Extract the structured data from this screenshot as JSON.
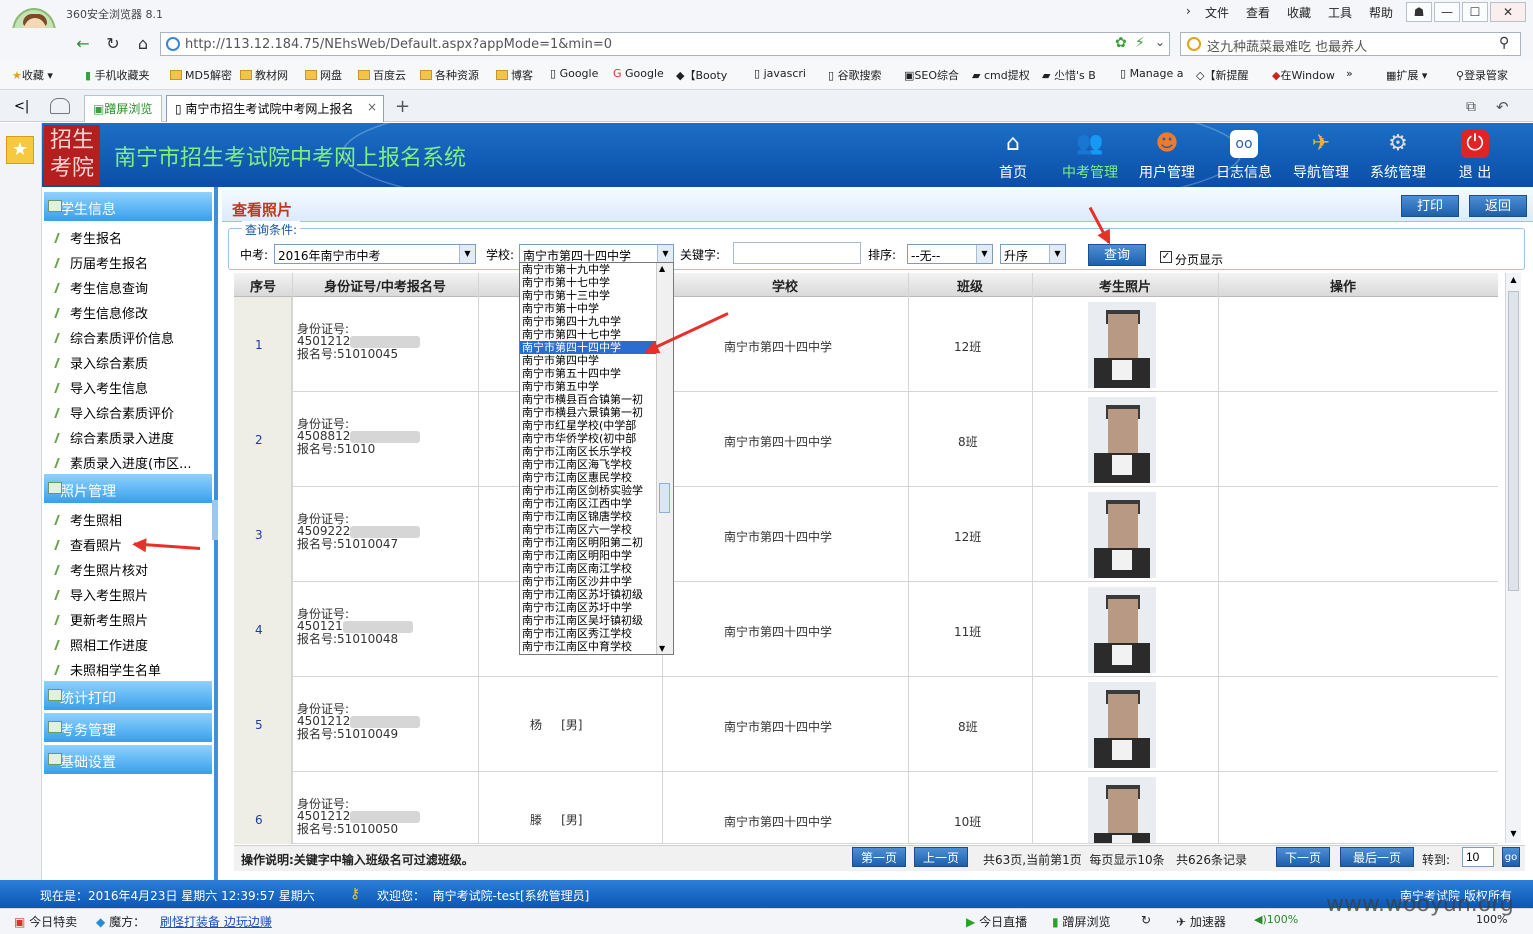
{
  "browser": {
    "app_name": "360安全浏览器 8.1",
    "menu": [
      "文件",
      "查看",
      "收藏",
      "工具",
      "帮助"
    ],
    "url": "http://113.12.184.75/NEhsWeb/Default.aspx?appMode=1&min=0",
    "search_text": "这九种蔬菜最难吃 也最养人",
    "bookmarks": [
      "收藏",
      "手机收藏夹",
      "MD5解密",
      "教材网",
      "网盘",
      "百度云",
      "各种资源",
      "博客",
      "Google",
      "Google",
      "【Booty",
      "javascri",
      "谷歌搜索",
      "SEO综合",
      "cmd提权",
      "尐惜's B",
      "Manage a",
      "【新提醒",
      "在Window"
    ],
    "bookmark_right": [
      "扩展",
      "登录管家"
    ],
    "tabs": [
      "蹭屏浏览",
      "南宁市招生考试院中考网上报名"
    ],
    "status_left": [
      "今日特卖",
      "魔方：",
      "刷怪打装备 边玩边赚"
    ],
    "status_right": [
      "今日直播",
      "蹭屏浏览",
      "加速器",
      "100%",
      "100%"
    ]
  },
  "app": {
    "title": "南宁市招生考试院中考网上报名系统",
    "seal_text": "招生考院",
    "nav": [
      "首页",
      "中考管理",
      "用户管理",
      "日志信息",
      "导航管理",
      "系统管理",
      "退 出"
    ],
    "status_text": "现在是：2016年4月23日 星期六 12:39:57 星期六",
    "welcome": "欢迎您：  南宁考试院-test[系统管理员]",
    "copyright": "南宁考试院 版权所有",
    "watermark": "www.wooyun.org"
  },
  "sidebar": {
    "sections": [
      "学生信息",
      "照片管理",
      "统计打印",
      "考务管理",
      "基础设置"
    ],
    "student_items": [
      "考生报名",
      "历届考生报名",
      "考生信息查询",
      "考生信息修改",
      "综合素质评价信息",
      "录入综合素质",
      "导入考生信息",
      "导入综合素质评价",
      "综合素质录入进度",
      "素质录入进度(市区..."
    ],
    "photo_items": [
      "考生照相",
      "查看照片",
      "考生照片核对",
      "导入考生照片",
      "更新考生照片",
      "照相工作进度",
      "未照相学生名单"
    ]
  },
  "main": {
    "page_title": "查看照片",
    "print_label": "打印",
    "back_label": "返回",
    "query_legend": "查询条件:",
    "exam_label": "中考:",
    "exam_value": "2016年南宁市中考",
    "school_label": "学校:",
    "school_value": "南宁市第四十四中学",
    "keyword_label": "关键字:",
    "keyword_value": "",
    "sort_label": "排序:",
    "sort_value": "--无--",
    "order_value": "升序",
    "query_button": "查询",
    "paging_label": "分页显示",
    "columns": [
      "序号",
      "身份证号/中考报名号",
      "学校",
      "班级",
      "考生照片",
      "操作"
    ],
    "rows": [
      {
        "seq": "1",
        "id1": "身份证号:",
        "id2": "4501212",
        "id3": "报名号:51010045",
        "name": "",
        "school": "南宁市第四十四中学",
        "class": "12班"
      },
      {
        "seq": "2",
        "id1": "身份证号:",
        "id2": "4508812",
        "id3": "报名号:51010",
        "name": "",
        "school": "南宁市第四十四中学",
        "class": "8班"
      },
      {
        "seq": "3",
        "id1": "身份证号:",
        "id2": "4509222",
        "id3": "报名号:51010047",
        "name": "",
        "school": "南宁市第四十四中学",
        "class": "12班"
      },
      {
        "seq": "4",
        "id1": "身份证号:",
        "id2": "450121",
        "id3": "报名号:51010048",
        "name": "",
        "school": "南宁市第四十四中学",
        "class": "11班"
      },
      {
        "seq": "5",
        "id1": "身份证号:",
        "id2": "4501212",
        "id3": "报名号:51010049",
        "name": "杨     [男]",
        "school": "南宁市第四十四中学",
        "class": "8班"
      },
      {
        "seq": "6",
        "id1": "身份证号:",
        "id2": "4501212",
        "id3": "报名号:51010050",
        "name": "滕     [男]",
        "school": "南宁市第四十四中学",
        "class": "10班"
      }
    ],
    "school_options": [
      "南宁市第十九中学",
      "南宁市第十七中学",
      "南宁市第十三中学",
      "南宁市第十中学",
      "南宁市第四十九中学",
      "南宁市第四十七中学",
      "南宁市第四十四中学",
      "南宁市第四中学",
      "南宁市第五十四中学",
      "南宁市第五中学",
      "南宁市横县百合镇第一初",
      "南宁市横县六景镇第一初",
      "南宁市红星学校(中学部",
      "南宁市华侨学校(初中部",
      "南宁市江南区长乐学校",
      "南宁市江南区海飞学校",
      "南宁市江南区惠民学校",
      "南宁市江南区剑桥实验学",
      "南宁市江南区江西中学",
      "南宁市江南区锦唐学校",
      "南宁市江南区六一学校",
      "南宁市江南区明阳第二初",
      "南宁市江南区明阳中学",
      "南宁市江南区南江学校",
      "南宁市江南区沙井中学",
      "南宁市江南区苏圩镇初级",
      "南宁市江南区苏圩中学",
      "南宁市江南区吴圩镇初级",
      "南宁市江南区秀江学校",
      "南宁市江南区中育学校"
    ],
    "highlight_index": 6,
    "note": "操作说明:关键字中输入班级名可过滤班级。",
    "pager": {
      "first": "第一页",
      "prev": "上一页",
      "info": "共63页,当前第1页  每页显示10条   共626条记录",
      "next": "下一页",
      "last": "最后一页",
      "goto_label": "转到:",
      "goto_value": "10",
      "go": "go"
    }
  }
}
